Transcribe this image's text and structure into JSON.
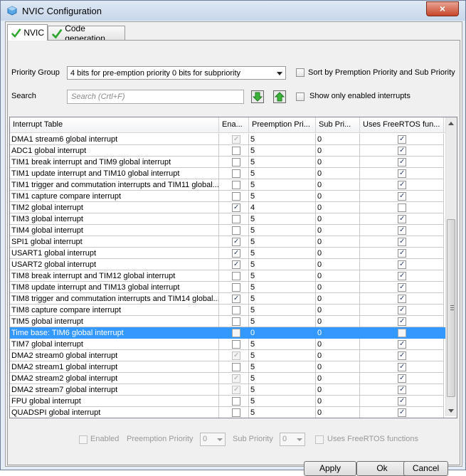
{
  "window": {
    "title": "NVIC Configuration",
    "close_label": "×"
  },
  "tabs": [
    {
      "label": "NVIC"
    },
    {
      "label": "Code generation"
    }
  ],
  "priority_group": {
    "label": "Priority Group",
    "value": "4 bits for pre-emption priority 0 bits for subpriority"
  },
  "sort_checkbox": {
    "label": "Sort by Premption Priority and Sub Priority",
    "checked": false
  },
  "search": {
    "label": "Search",
    "placeholder": "Search (Crtl+F)"
  },
  "show_enabled_checkbox": {
    "label": "Show only enabled interrupts",
    "checked": false
  },
  "table": {
    "headers": [
      "Interrupt Table",
      "Ena...",
      "Preemption Pri...",
      "Sub Pri...",
      "Uses FreeRTOS fun..."
    ],
    "rows": [
      {
        "name": "DMA1 stream6 global interrupt",
        "enabled": true,
        "enabled_disabled": true,
        "pre": "5",
        "sub": "0",
        "freertos": true
      },
      {
        "name": "ADC1 global interrupt",
        "enabled": false,
        "enabled_disabled": false,
        "pre": "5",
        "sub": "0",
        "freertos": true
      },
      {
        "name": "TIM1 break interrupt and TIM9 global interrupt",
        "enabled": false,
        "enabled_disabled": false,
        "pre": "5",
        "sub": "0",
        "freertos": true
      },
      {
        "name": "TIM1 update interrupt and TIM10 global interrupt",
        "enabled": false,
        "enabled_disabled": false,
        "pre": "5",
        "sub": "0",
        "freertos": true
      },
      {
        "name": "TIM1 trigger and commutation interrupts and TIM11 global...",
        "enabled": false,
        "enabled_disabled": false,
        "pre": "5",
        "sub": "0",
        "freertos": true
      },
      {
        "name": "TIM1 capture compare interrupt",
        "enabled": false,
        "enabled_disabled": false,
        "pre": "5",
        "sub": "0",
        "freertos": true
      },
      {
        "name": "TIM2 global interrupt",
        "enabled": true,
        "enabled_disabled": false,
        "pre": "4",
        "sub": "0",
        "freertos": false
      },
      {
        "name": "TIM3 global interrupt",
        "enabled": false,
        "enabled_disabled": false,
        "pre": "5",
        "sub": "0",
        "freertos": true
      },
      {
        "name": "TIM4 global interrupt",
        "enabled": false,
        "enabled_disabled": false,
        "pre": "5",
        "sub": "0",
        "freertos": true
      },
      {
        "name": "SPI1 global interrupt",
        "enabled": true,
        "enabled_disabled": false,
        "pre": "5",
        "sub": "0",
        "freertos": true
      },
      {
        "name": "USART1 global interrupt",
        "enabled": true,
        "enabled_disabled": false,
        "pre": "5",
        "sub": "0",
        "freertos": true
      },
      {
        "name": "USART2 global interrupt",
        "enabled": true,
        "enabled_disabled": false,
        "pre": "5",
        "sub": "0",
        "freertos": true
      },
      {
        "name": "TIM8 break interrupt and TIM12 global interrupt",
        "enabled": false,
        "enabled_disabled": false,
        "pre": "5",
        "sub": "0",
        "freertos": true
      },
      {
        "name": "TIM8 update interrupt and TIM13 global interrupt",
        "enabled": false,
        "enabled_disabled": false,
        "pre": "5",
        "sub": "0",
        "freertos": true
      },
      {
        "name": "TIM8 trigger and commutation interrupts and TIM14 global...",
        "enabled": true,
        "enabled_disabled": false,
        "pre": "5",
        "sub": "0",
        "freertos": true
      },
      {
        "name": "TIM8 capture compare interrupt",
        "enabled": false,
        "enabled_disabled": false,
        "pre": "5",
        "sub": "0",
        "freertos": true
      },
      {
        "name": "TIM5 global interrupt",
        "enabled": false,
        "enabled_disabled": false,
        "pre": "5",
        "sub": "0",
        "freertos": true
      },
      {
        "name": "Time base: TIM6 global interrupt",
        "enabled": true,
        "enabled_disabled": false,
        "pre": "0",
        "sub": "0",
        "freertos": false,
        "selected": true
      },
      {
        "name": "TIM7 global interrupt",
        "enabled": false,
        "enabled_disabled": false,
        "pre": "5",
        "sub": "0",
        "freertos": true
      },
      {
        "name": "DMA2 stream0 global interrupt",
        "enabled": true,
        "enabled_disabled": true,
        "pre": "5",
        "sub": "0",
        "freertos": true
      },
      {
        "name": "DMA2 stream1 global interrupt",
        "enabled": false,
        "enabled_disabled": false,
        "pre": "5",
        "sub": "0",
        "freertos": true
      },
      {
        "name": "DMA2 stream2 global interrupt",
        "enabled": true,
        "enabled_disabled": true,
        "pre": "5",
        "sub": "0",
        "freertos": true
      },
      {
        "name": "DMA2 stream7 global interrupt",
        "enabled": true,
        "enabled_disabled": true,
        "pre": "5",
        "sub": "0",
        "freertos": true
      },
      {
        "name": "FPU global interrupt",
        "enabled": false,
        "enabled_disabled": false,
        "pre": "5",
        "sub": "0",
        "freertos": true
      },
      {
        "name": "QUADSPI global interrupt",
        "enabled": false,
        "enabled_disabled": false,
        "pre": "5",
        "sub": "0",
        "freertos": true
      }
    ]
  },
  "detail": {
    "enabled_label": "Enabled",
    "preemption_label": "Preemption Priority",
    "preemption_value": "0",
    "sub_label": "Sub Priority",
    "sub_value": "0",
    "freertos_label": "Uses FreeRTOS functions"
  },
  "buttons": {
    "apply": "Apply",
    "ok": "Ok",
    "cancel": "Cancel"
  },
  "colors": {
    "selection": "#3399ff",
    "check_green": "#2ea52e"
  }
}
